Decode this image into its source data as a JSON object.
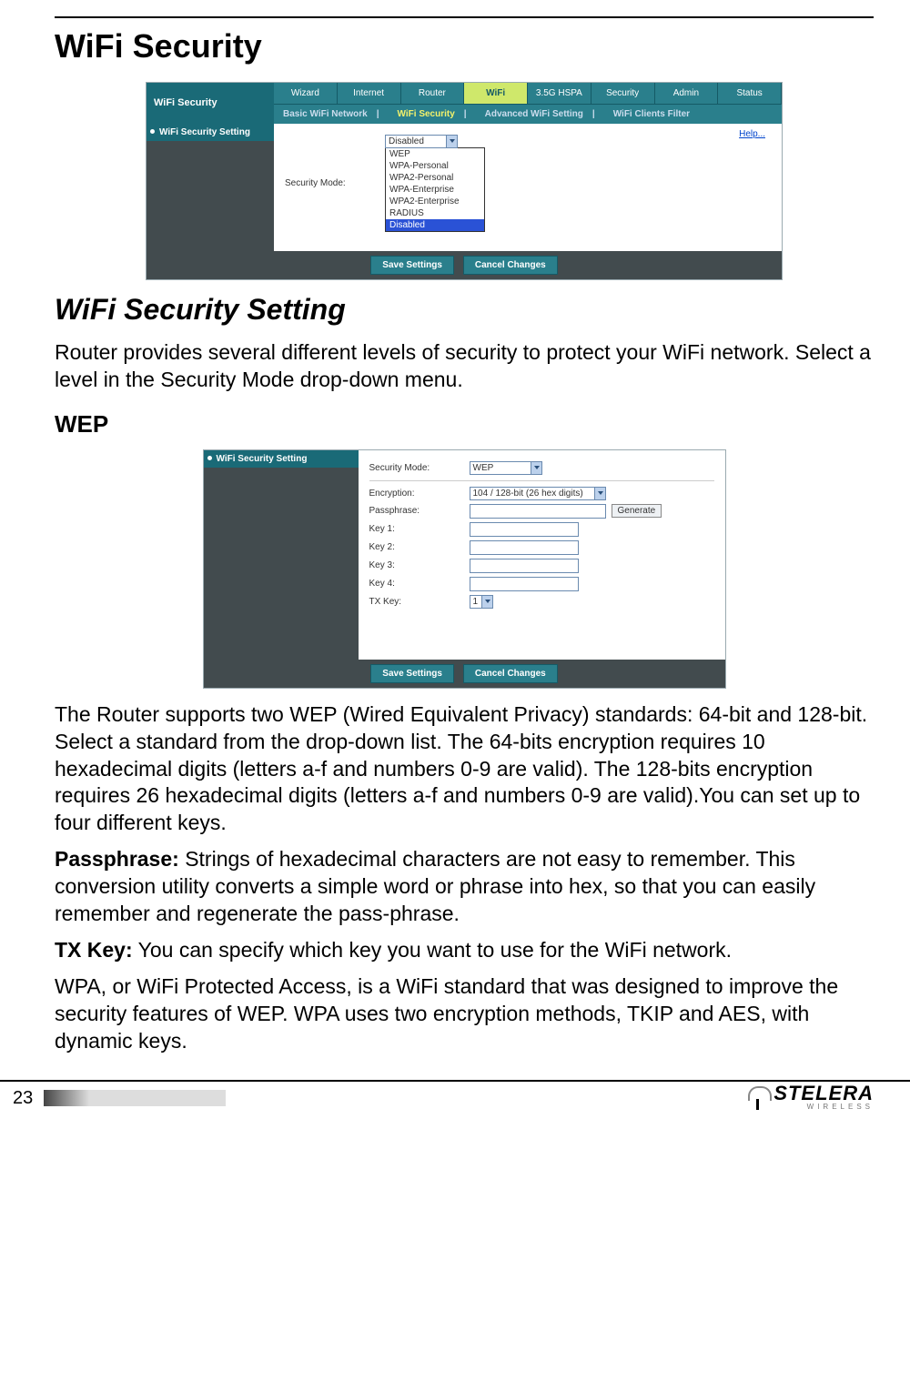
{
  "page": {
    "heading": "WiFi Security",
    "sub_heading": "WiFi Security Setting",
    "intro": "Router provides several different levels of security to protect your WiFi network. Select a level in the Security Mode drop-down menu.",
    "wep_heading": "WEP",
    "wep_para1": "The Router supports two WEP (Wired Equivalent Privacy) standards: 64-bit and 128-bit. Select a standard from the drop-down list. The 64-bits encryption requires 10 hexadecimal digits (letters a-f and numbers 0-9 are valid). The 128-bits encryption requires 26 hexadecimal digits (letters a-f and numbers 0-9 are valid).You can set up to four different keys.",
    "pass_label": "Passphrase:",
    "pass_text": " Strings of hexadecimal characters are not easy to remember. This conversion utility converts a simple word or phrase into hex, so that you can easily remember and regenerate the pass-phrase.",
    "tx_label": "TX Key:",
    "tx_text": " You can specify which key you want to use for the WiFi network.",
    "wpa_text": "WPA, or WiFi Protected Access, is a WiFi standard that was designed to improve the security features of WEP. WPA uses two encryption methods, TKIP and AES, with dynamic keys.",
    "page_number": "23"
  },
  "panel1": {
    "title": "WiFi Security",
    "tabs": [
      "Wizard",
      "Internet",
      "Router",
      "WiFi",
      "3.5G HSPA",
      "Security",
      "Admin",
      "Status"
    ],
    "active_tab": "WiFi",
    "subtabs": [
      "Basic WiFi Network",
      "WiFi Security",
      "Advanced WiFi Setting",
      "WiFi Clients Filter"
    ],
    "active_subtab": "WiFi Security",
    "sidebar_item": "WiFi Security Setting",
    "help": "Help...",
    "security_mode_label": "Security Mode:",
    "security_mode_value": "Disabled",
    "options": [
      "WEP",
      "WPA-Personal",
      "WPA2-Personal",
      "WPA-Enterprise",
      "WPA2-Enterprise",
      "RADIUS",
      "Disabled"
    ],
    "highlighted_option": "Disabled",
    "save_btn": "Save Settings",
    "cancel_btn": "Cancel Changes"
  },
  "panel2": {
    "sidebar_item": "WiFi Security Setting",
    "security_mode_label": "Security Mode:",
    "security_mode_value": "WEP",
    "encryption_label": "Encryption:",
    "encryption_value": "104 / 128-bit (26 hex digits)",
    "passphrase_label": "Passphrase:",
    "passphrase_value": "",
    "generate_btn": "Generate",
    "key1_label": "Key 1:",
    "key2_label": "Key 2:",
    "key3_label": "Key 3:",
    "key4_label": "Key 4:",
    "txkey_label": "TX Key:",
    "txkey_value": "1",
    "save_btn": "Save Settings",
    "cancel_btn": "Cancel Changes"
  },
  "footer": {
    "brand": "STELERA",
    "sub": "WIRELESS"
  }
}
